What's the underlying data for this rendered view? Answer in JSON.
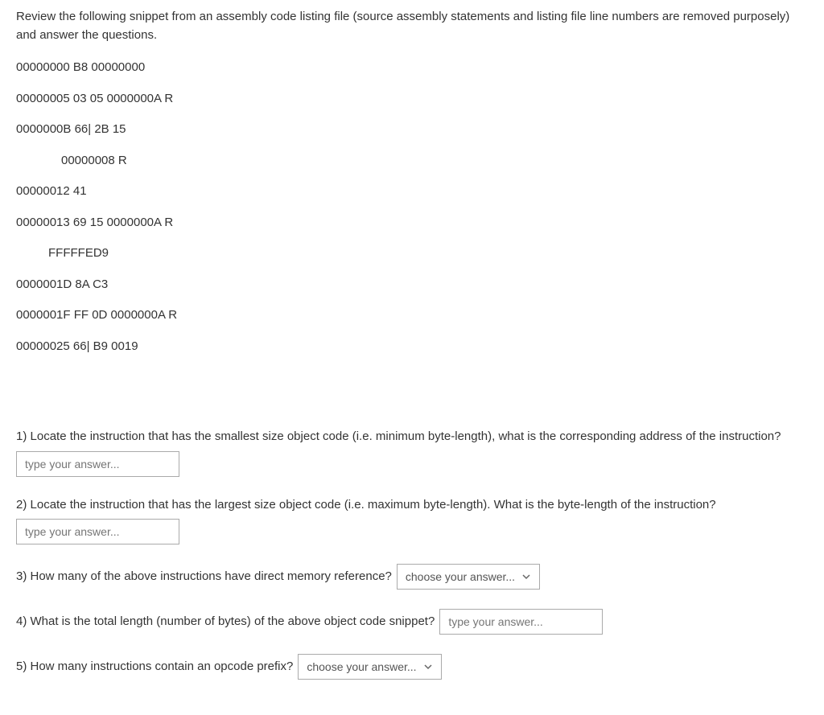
{
  "instruction": "Review the following snippet from an assembly code listing file (source assembly statements and listing file line numbers are removed purposely) and answer the questions.",
  "code": {
    "l1": "00000000  B8 00000000",
    "l2": "00000005  03 05 0000000A R",
    "l3": "0000000B  66| 2B 15",
    "l4": "00000008 R",
    "l5": "00000012  41",
    "l6": "00000013  69 15 0000000A R",
    "l7": "FFFFFED9",
    "l8": "0000001D  8A C3",
    "l9": "0000001F  FF 0D 0000000A R",
    "l10": "00000025  66| B9 0019"
  },
  "questions": {
    "q1": "1) Locate the instruction that has the  smallest size object code (i.e. minimum byte-length), what is the corresponding address of the instruction?",
    "q2": "2) Locate the instruction that has the largest size object code (i.e. maximum byte-length). What is the byte-length of the instruction?",
    "q3": "3) How many of the above instructions have direct memory reference?",
    "q4": "4) What is the total length (number of bytes) of the above object code snippet?",
    "q5": "5) How many instructions contain an opcode prefix?"
  },
  "placeholders": {
    "text": "type your answer...",
    "select": "choose your answer..."
  }
}
